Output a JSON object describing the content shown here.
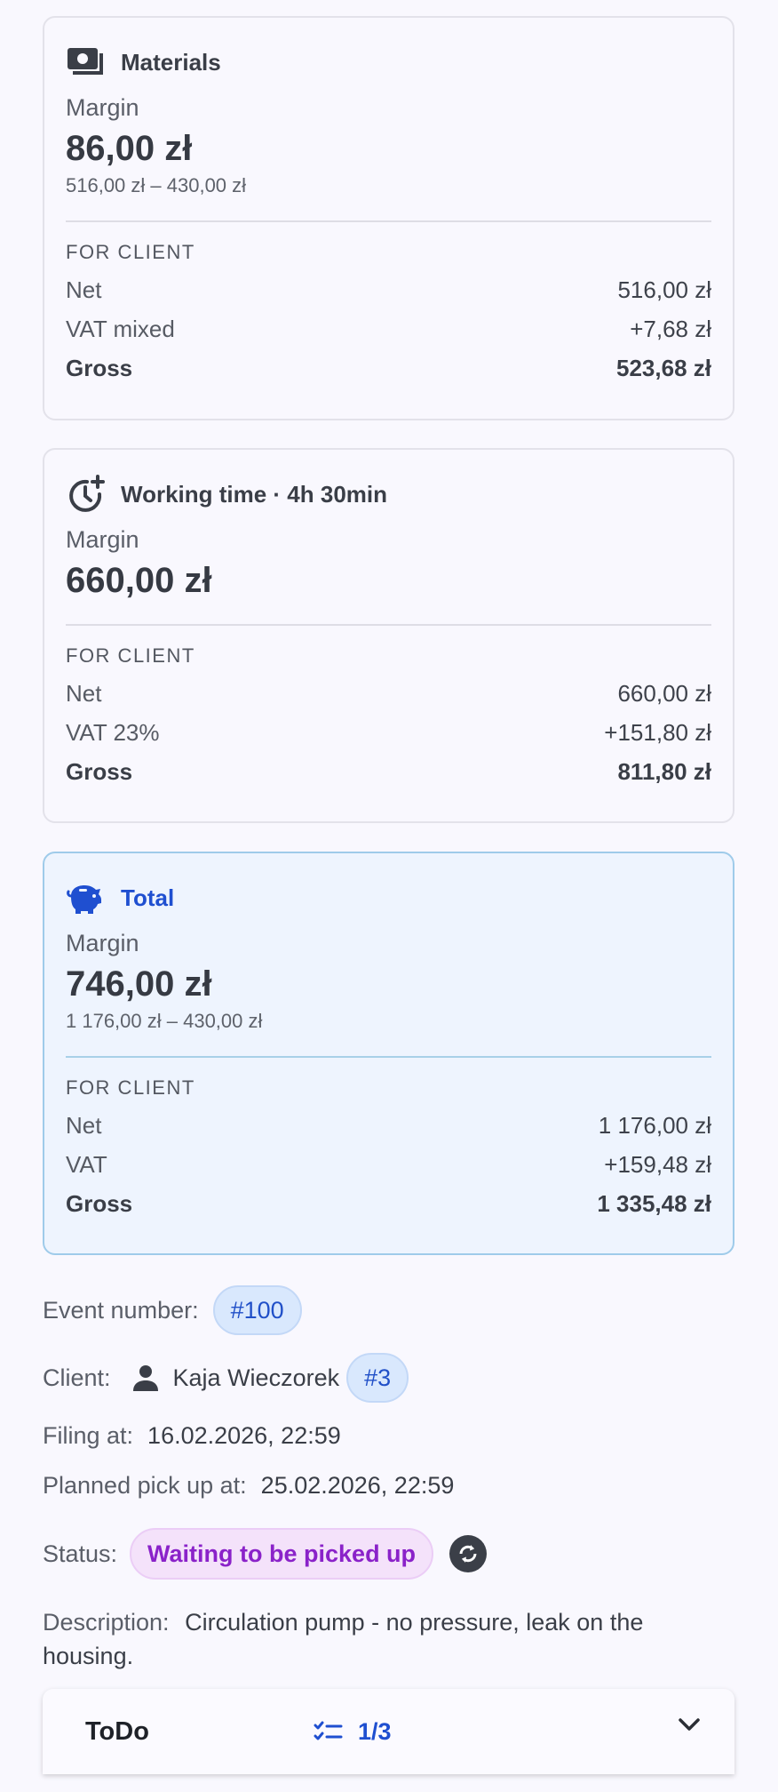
{
  "cards": [
    {
      "icon": "cash-icon",
      "title": "Materials",
      "margin_label": "Margin",
      "margin_value": "86,00 zł",
      "margin_sub": "516,00 zł – 430,00 zł",
      "section_label": "FOR CLIENT",
      "net_label": "Net",
      "net_value": "516,00 zł",
      "vat_label": "VAT mixed",
      "vat_value": "+7,68 zł",
      "gross_label": "Gross",
      "gross_value": "523,68 zł"
    },
    {
      "icon": "clock-plus-icon",
      "title": "Working time · 4h 30min",
      "margin_label": "Margin",
      "margin_value": "660,00 zł",
      "section_label": "FOR CLIENT",
      "net_label": "Net",
      "net_value": "660,00 zł",
      "vat_label": "VAT 23%",
      "vat_value": "+151,80 zł",
      "gross_label": "Gross",
      "gross_value": "811,80 zł"
    },
    {
      "icon": "piggy-bank-icon",
      "title": "Total",
      "margin_label": "Margin",
      "margin_value": "746,00 zł",
      "margin_sub": "1 176,00 zł – 430,00 zł",
      "section_label": "FOR CLIENT",
      "net_label": "Net",
      "net_value": "1 176,00 zł",
      "vat_label": "VAT",
      "vat_value": "+159,48 zł",
      "gross_label": "Gross",
      "gross_value": "1 335,48 zł"
    }
  ],
  "details": {
    "event_label": "Event number:",
    "event_value": "#100",
    "client_label": "Client:",
    "client_name": "Kaja Wieczorek",
    "client_id": "#3",
    "filing_label": "Filing at:",
    "filing_value": "16.02.2026, 22:59",
    "pickup_label": "Planned pick up at:",
    "pickup_value": "25.02.2026, 22:59",
    "status_label": "Status:",
    "status_value": "Waiting to be picked up",
    "description_label": "Description:",
    "description_value": "Circulation pump - no pressure, leak on the housing."
  },
  "todo": {
    "title": "ToDo",
    "count": "1/3"
  },
  "colors": {
    "accent": "#1f4fd0",
    "status": "#8a22c9",
    "total_bg": "#eef4fe"
  }
}
